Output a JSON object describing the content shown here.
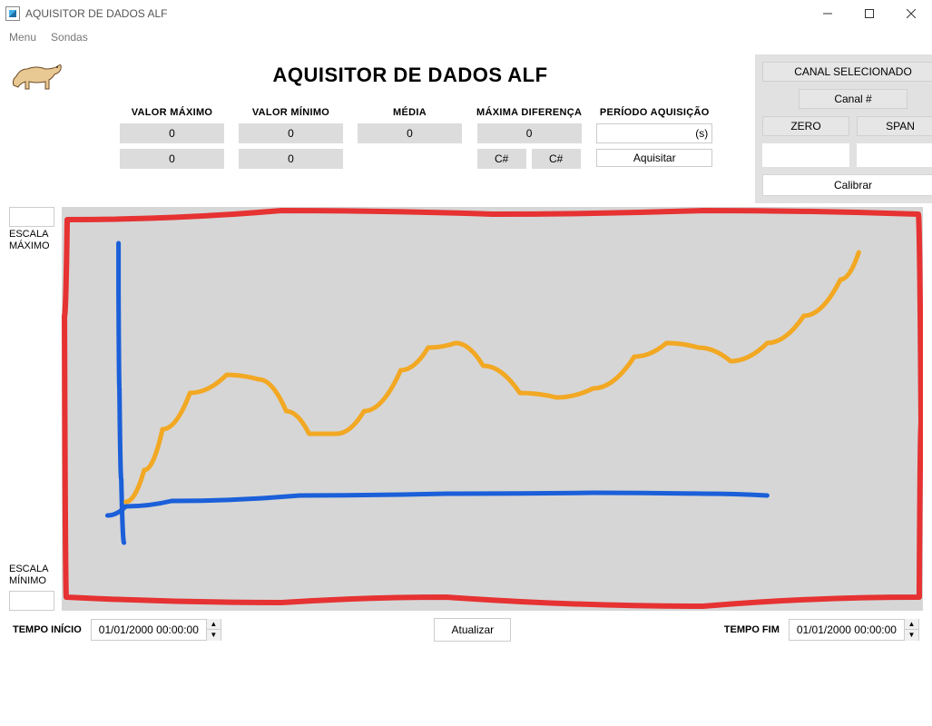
{
  "window": {
    "title": "AQUISITOR DE DADOS ALF"
  },
  "menu": {
    "menu": "Menu",
    "sondas": "Sondas"
  },
  "title": "AQUISITOR DE DADOS ALF",
  "stats": {
    "valor_maximo": {
      "label": "VALOR MÁXIMO",
      "line1": "0",
      "line2": "0"
    },
    "valor_minimo": {
      "label": "VALOR MÍNIMO",
      "line1": "0",
      "line2": "0"
    },
    "media": {
      "label": "MÉDIA",
      "line1": "0"
    },
    "maxima_dif": {
      "label": "MÁXIMA DIFERENÇA",
      "line1": "0",
      "c1": "C#",
      "c2": "C#"
    },
    "periodo": {
      "label": "PERÍODO AQUISIÇÃO",
      "unit": "(s)",
      "button": "Aquisitar"
    }
  },
  "cal": {
    "canal_sel": "CANAL SELECIONADO",
    "canal": "Canal #",
    "zero": "ZERO",
    "span": "SPAN",
    "calibrar": "Calibrar"
  },
  "scale": {
    "max_label": "ESCALA\nMÁXIMO",
    "min_label": "ESCALA\nMÍNIMO"
  },
  "bottom": {
    "tempo_inicio_lbl": "TEMPO INÍCIO",
    "tempo_inicio_val": "01/01/2000 00:00:00",
    "tempo_fim_lbl": "TEMPO FIM",
    "tempo_fim_val": "01/01/2000 00:00:00",
    "atualizar": "Atualizar"
  },
  "chart_data": {
    "type": "line",
    "xlabel": "",
    "ylabel": "",
    "xlim": [
      0,
      940
    ],
    "ylim": [
      0,
      445
    ],
    "comment": "Sketch curves — values are approximate pixel-space coordinates read from the hand-drawn chart, origin at top-left of the grey plot box. y increases downward.",
    "series": [
      {
        "name": "red-outline",
        "color": "#e63232",
        "points": [
          [
            5,
            430
          ],
          [
            3,
            120
          ],
          [
            6,
            14
          ],
          [
            240,
            4
          ],
          [
            470,
            8
          ],
          [
            700,
            4
          ],
          [
            935,
            8
          ],
          [
            938,
            240
          ],
          [
            936,
            430
          ],
          [
            700,
            440
          ],
          [
            420,
            430
          ],
          [
            240,
            436
          ],
          [
            5,
            430
          ]
        ]
      },
      {
        "name": "blue-horizontal",
        "color": "#1b5fd9",
        "points": [
          [
            50,
            340
          ],
          [
            70,
            330
          ],
          [
            120,
            324
          ],
          [
            260,
            318
          ],
          [
            420,
            316
          ],
          [
            580,
            315
          ],
          [
            700,
            316
          ],
          [
            770,
            318
          ]
        ]
      },
      {
        "name": "blue-vertical",
        "color": "#1b5fd9",
        "points": [
          [
            68,
            370
          ],
          [
            65,
            300
          ],
          [
            63,
            200
          ],
          [
            62,
            90
          ],
          [
            62,
            40
          ]
        ]
      },
      {
        "name": "orange-curve",
        "color": "#f2a823",
        "points": [
          [
            70,
            325
          ],
          [
            90,
            290
          ],
          [
            110,
            245
          ],
          [
            140,
            205
          ],
          [
            180,
            185
          ],
          [
            215,
            190
          ],
          [
            245,
            225
          ],
          [
            270,
            250
          ],
          [
            300,
            250
          ],
          [
            330,
            225
          ],
          [
            370,
            180
          ],
          [
            400,
            155
          ],
          [
            430,
            150
          ],
          [
            460,
            175
          ],
          [
            500,
            205
          ],
          [
            540,
            210
          ],
          [
            580,
            200
          ],
          [
            625,
            165
          ],
          [
            660,
            150
          ],
          [
            695,
            155
          ],
          [
            730,
            170
          ],
          [
            770,
            150
          ],
          [
            810,
            120
          ],
          [
            850,
            80
          ],
          [
            870,
            50
          ]
        ]
      }
    ]
  }
}
